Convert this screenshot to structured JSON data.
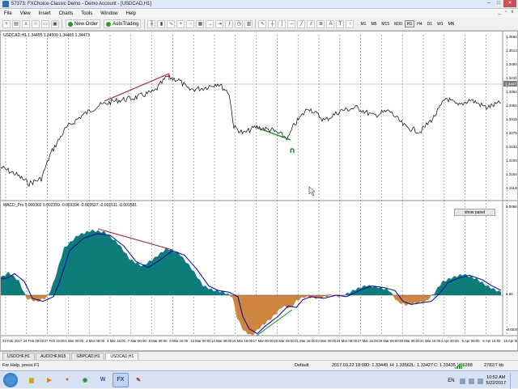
{
  "window": {
    "title": "57373: FXChoice-Classic Demo - Demo Account - [USDCAD,H1]",
    "minimize": "–",
    "maximize": "□",
    "close": "✕"
  },
  "menu": {
    "items": [
      "File",
      "View",
      "Insert",
      "Charts",
      "Tools",
      "Window",
      "Help"
    ],
    "mdi_min": "_",
    "mdi_restore": "▫",
    "mdi_close": "x"
  },
  "toolbar": {
    "new_order": "New Order",
    "auto_trading": "AutoTrading",
    "timeframes": [
      "M1",
      "M5",
      "M15",
      "M30",
      "H1",
      "H4",
      "D1",
      "W1",
      "MN"
    ],
    "active_timeframe": "H1",
    "icons": [
      "new-chart-icon",
      "profiles-icon",
      "market-watch-icon",
      "navigator-icon",
      "terminal-icon",
      "strategy-tester-icon",
      "zoom-in-icon",
      "zoom-out-icon",
      "crosshair-icon",
      "line-icon",
      "periods-icon",
      "templates-icon"
    ]
  },
  "chart": {
    "symbol_label": "USDCAD,H1  1.34495 1.34500 1.34465 1.34473",
    "indicator_label": "MACD_Pro 0.000302 0.002359 -0.003394 -0.002627 -0.001611 -0.001581",
    "show_panel": "show panel",
    "current_price": "1.34473",
    "price_axis": [
      "1.35605",
      "1.35135",
      "1.34840",
      "1.34315",
      "1.33945",
      "1.33515",
      "1.33115",
      "1.32755",
      "1.32325",
      "1.31935",
      "1.31545",
      "1.31140"
    ],
    "indicator_axis": [
      "0.006675",
      "0.00",
      "-0.003967"
    ],
    "time_axis": [
      "23 Feb 2017",
      "24 Feb 08:00",
      "27 Feb 16:00",
      "1 Mar 00:00",
      "2 Mar 08:00",
      "3 Mar 16:00",
      "7 Mar 00:00",
      "8 Mar 08:00",
      "9 Mar 16:00",
      "13 Mar 00:00",
      "14 Mar 08:00",
      "15 Mar 16:00",
      "17 Mar 00:00",
      "20 Mar 08:00",
      "21 Mar 16:00",
      "23 Mar 00:00",
      "24 Mar 08:00",
      "27 Mar 16:00",
      "29 Mar 00:00",
      "30 Mar 08:00",
      "31 Mar 16:00",
      "4 Apr 00:00",
      "5 Apr 08:00",
      "6 Apr 16:00",
      "10 Apr 00:00"
    ],
    "arrow_up_label": "↑",
    "arrow_down_label": "∩",
    "colors": {
      "price_line": "#000000",
      "hist_positive": "#0e7c7b",
      "hist_negative": "#cd853f",
      "signal_line": "#0000aa",
      "bear_divergence": "#a0203a",
      "bull_divergence": "#118c11",
      "grid": "#7a7a7a"
    }
  },
  "tabs": [
    "USDCHF,H1",
    "AUDCHF,M15",
    "GBPCAD,H1",
    "USDCAD,H1"
  ],
  "active_tab": "USDCAD,H1",
  "status": {
    "help": "For Help, press F1",
    "profile": "Default",
    "datetime": "2017.03.22 18:00",
    "open": "O: 1.33449",
    "high": "H: 1.33562",
    "low": "L: 1.33427",
    "close": "C: 1.33435",
    "volume": "V: 6288",
    "traffic": "2782/7 kb"
  },
  "taskbar": {
    "apps": [
      "windows-explorer",
      "media-player",
      "firefox",
      "chrome",
      "word",
      "metatrader",
      "paint"
    ],
    "language": "EN",
    "time": "10:52 AM",
    "date": "5/22/2017"
  }
}
